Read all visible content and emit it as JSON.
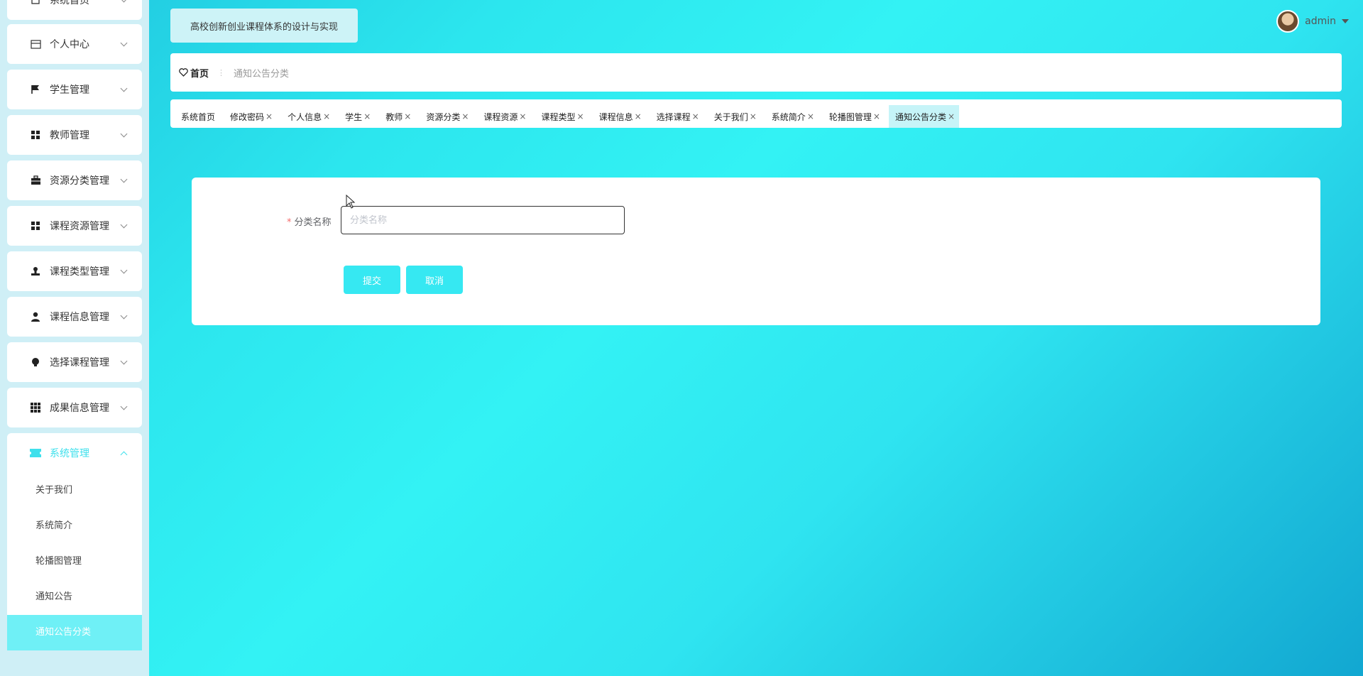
{
  "app": {
    "title": "高校创新创业课程体系的设计与实现"
  },
  "user": {
    "name": "admin"
  },
  "sidebar": {
    "groups": [
      {
        "label": "系统首页",
        "icon": "home-icon"
      },
      {
        "label": "个人中心",
        "icon": "card-icon"
      },
      {
        "label": "学生管理",
        "icon": "flag-icon"
      },
      {
        "label": "教师管理",
        "icon": "grid-icon"
      },
      {
        "label": "资源分类管理",
        "icon": "briefcase-icon"
      },
      {
        "label": "课程资源管理",
        "icon": "grid-icon"
      },
      {
        "label": "课程类型管理",
        "icon": "stamp-icon"
      },
      {
        "label": "课程信息管理",
        "icon": "user-icon"
      },
      {
        "label": "选择课程管理",
        "icon": "bulb-icon"
      },
      {
        "label": "成果信息管理",
        "icon": "apps-icon"
      },
      {
        "label": "系统管理",
        "icon": "ticket-icon"
      }
    ],
    "submenu": [
      "关于我们",
      "系统简介",
      "轮播图管理",
      "通知公告",
      "通知公告分类"
    ]
  },
  "breadcrumb": {
    "home": "首页",
    "separator": "⋮",
    "current": "通知公告分类"
  },
  "tags": [
    {
      "label": "系统首页",
      "closable": false
    },
    {
      "label": "修改密码",
      "closable": true
    },
    {
      "label": "个人信息",
      "closable": true
    },
    {
      "label": "学生",
      "closable": true
    },
    {
      "label": "教师",
      "closable": true
    },
    {
      "label": "资源分类",
      "closable": true
    },
    {
      "label": "课程资源",
      "closable": true
    },
    {
      "label": "课程类型",
      "closable": true
    },
    {
      "label": "课程信息",
      "closable": true
    },
    {
      "label": "选择课程",
      "closable": true
    },
    {
      "label": "关于我们",
      "closable": true
    },
    {
      "label": "系统简介",
      "closable": true
    },
    {
      "label": "轮播图管理",
      "closable": true
    },
    {
      "label": "通知公告分类",
      "closable": true
    }
  ],
  "form": {
    "field_label": "分类名称",
    "required_mark": "*",
    "field_value": "",
    "field_placeholder": "分类名称",
    "submit_label": "提交",
    "cancel_label": "取消"
  },
  "colors": {
    "accent": "#36e8f2",
    "sidebar_bg": "#cfeff6",
    "active_tag": "#c6f4f8",
    "required": "#f56c6c"
  }
}
